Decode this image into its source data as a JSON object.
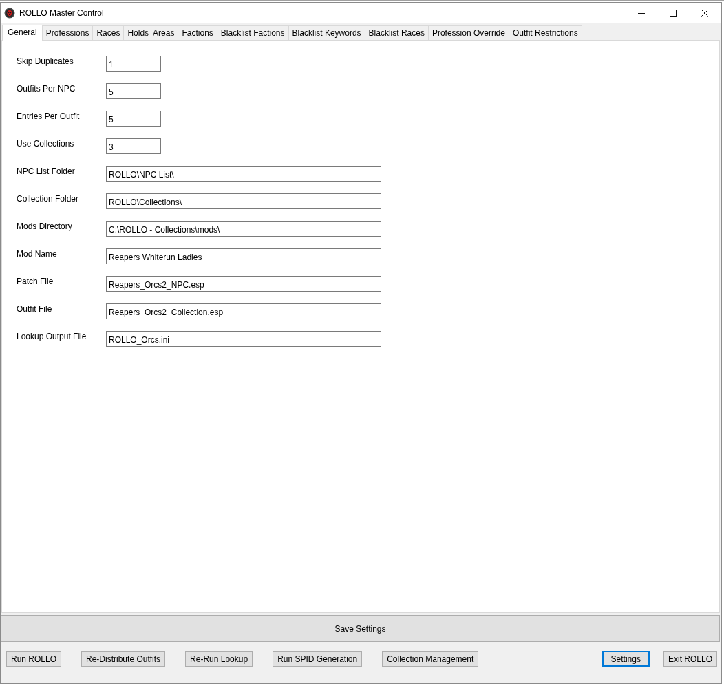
{
  "window": {
    "title": "ROLLO Master Control"
  },
  "tabs": [
    {
      "label": "General",
      "selected": true
    },
    {
      "label": "Professions",
      "selected": false
    },
    {
      "label": "Races",
      "selected": false
    },
    {
      "label": "Holds  Areas",
      "selected": false
    },
    {
      "label": "Factions",
      "selected": false
    },
    {
      "label": "Blacklist Factions",
      "selected": false
    },
    {
      "label": "Blacklist Keywords",
      "selected": false
    },
    {
      "label": "Blacklist Races",
      "selected": false
    },
    {
      "label": "Profession Override",
      "selected": false
    },
    {
      "label": "Outfit Restrictions",
      "selected": false
    }
  ],
  "fields": [
    {
      "label": "Skip Duplicates",
      "value": "1",
      "kind": "short"
    },
    {
      "label": "Outfits Per NPC",
      "value": "5",
      "kind": "short"
    },
    {
      "label": "Entries Per Outfit",
      "value": "5",
      "kind": "short"
    },
    {
      "label": "Use Collections",
      "value": "3",
      "kind": "short"
    },
    {
      "label": "NPC List Folder",
      "value": "ROLLO\\NPC List\\",
      "kind": "long"
    },
    {
      "label": "Collection Folder",
      "value": "ROLLO\\Collections\\",
      "kind": "long"
    },
    {
      "label": "Mods Directory",
      "value": "C:\\ROLLO - Collections\\mods\\",
      "kind": "long"
    },
    {
      "label": "Mod Name",
      "value": "Reapers Whiterun Ladies",
      "kind": "long"
    },
    {
      "label": "Patch File",
      "value": "Reapers_Orcs2_NPC.esp",
      "kind": "long"
    },
    {
      "label": "Outfit File",
      "value": "Reapers_Orcs2_Collection.esp",
      "kind": "long"
    },
    {
      "label": "Lookup Output File",
      "value": "ROLLO_Orcs.ini",
      "kind": "long"
    }
  ],
  "save_button": "Save Settings",
  "action_buttons": [
    {
      "label": "Run ROLLO",
      "focused": false
    },
    {
      "label": "Re-Distribute Outfits",
      "focused": false
    },
    {
      "label": "Re-Run Lookup",
      "focused": false
    },
    {
      "label": "Run SPID Generation",
      "focused": false
    },
    {
      "label": "Collection Management",
      "focused": false
    }
  ],
  "dialog_buttons": [
    {
      "label": "Settings",
      "focused": true
    },
    {
      "label": "Exit ROLLO",
      "focused": false
    }
  ]
}
